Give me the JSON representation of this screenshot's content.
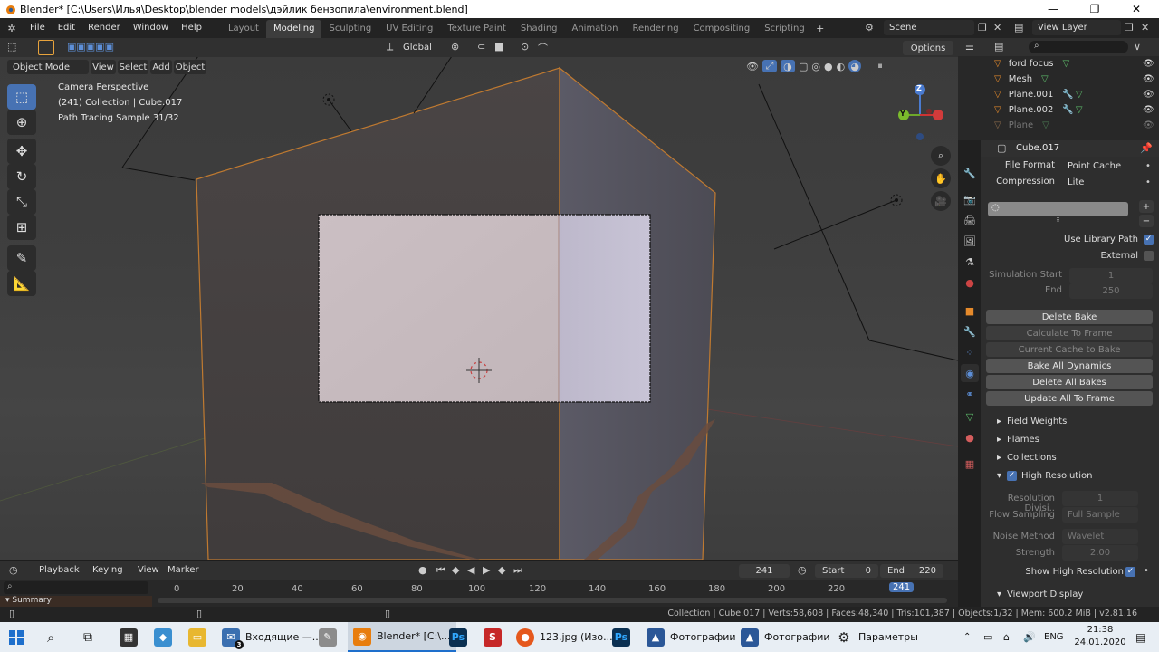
{
  "window": {
    "title": "Blender* [C:\\Users\\Илья\\Desktop\\blender models\\дэйлик бензопила\\environment.blend]",
    "min": "—",
    "max": "❐",
    "close": "✕"
  },
  "menu": [
    "File",
    "Edit",
    "Render",
    "Window",
    "Help"
  ],
  "workspaces": [
    "Layout",
    "Modeling",
    "Sculpting",
    "UV Editing",
    "Texture Paint",
    "Shading",
    "Animation",
    "Rendering",
    "Compositing",
    "Scripting"
  ],
  "active_workspace": "Modeling",
  "scene_field": "Scene",
  "view_layer_field": "View Layer",
  "viewport_header": {
    "mode": "Object Mode",
    "view": "View",
    "select": "Select",
    "add": "Add",
    "object": "Object",
    "transform_orientation": "Global",
    "options": "Options"
  },
  "viewport_overlay_text": {
    "line1": "Camera Perspective",
    "line2": "(241) Collection | Cube.017",
    "line3": "Path Tracing Sample 31/32"
  },
  "gizmo": {
    "x": "X",
    "y": "Y",
    "z": "Z"
  },
  "outliner": {
    "search_placeholder": "",
    "items": [
      {
        "name": "ford focus",
        "dim": false
      },
      {
        "name": "Mesh",
        "dim": false
      },
      {
        "name": "Plane.001",
        "dim": false
      },
      {
        "name": "Plane.002",
        "dim": false
      },
      {
        "name": "Plane",
        "dim": true
      }
    ]
  },
  "properties": {
    "object_name": "Cube.017",
    "file_format_label": "File Format",
    "file_format_value": "Point Cache",
    "compression_label": "Compression",
    "compression_value": "Lite",
    "use_library_path": "Use Library Path",
    "external": "External",
    "simulation_start_label": "Simulation Start",
    "simulation_start_value": "1",
    "end_label": "End",
    "end_value": "250",
    "buttons": [
      "Delete Bake",
      "Calculate To Frame",
      "Current Cache to Bake",
      "Bake All Dynamics",
      "Delete All Bakes",
      "Update All To Frame"
    ],
    "panels": [
      "Field Weights",
      "Flames",
      "Collections"
    ],
    "high_resolution": "High Resolution",
    "resolution_divisions_label": "Resolution Divisi..",
    "resolution_divisions_value": "1",
    "flow_sampling_label": "Flow Sampling",
    "flow_sampling_value": "Full Sample",
    "noise_method_label": "Noise Method",
    "noise_method_value": "Wavelet",
    "strength_label": "Strength",
    "strength_value": "2.00",
    "show_high_resolution": "Show High Resolution",
    "viewport_display": "Viewport Display"
  },
  "timeline": {
    "playback": "Playback",
    "keying": "Keying",
    "view": "View",
    "marker": "Marker",
    "current_frame": "241",
    "start_label": "Start",
    "start_value": "0",
    "end_label": "End",
    "end_value": "220",
    "ticks": [
      "0",
      "20",
      "40",
      "60",
      "80",
      "100",
      "120",
      "140",
      "160",
      "180",
      "200",
      "220"
    ],
    "playhead": "241",
    "summary": "Summary"
  },
  "statusbar": {
    "text": "Collection | Cube.017 | Verts:58,608 | Faces:48,340 | Tris:101,387 | Objects:1/32 | Mem: 600.2 MiB | v2.81.16"
  },
  "taskbar": {
    "items": [
      {
        "label": "Входящие —...",
        "color": "#3a6fb0",
        "icon": "mail-icon"
      },
      {
        "label": "Blender* [C:\\...",
        "color": "#e87d0d",
        "icon": "blender-icon"
      },
      {
        "label": "123.jpg (Изо...",
        "color": "#e5581d",
        "icon": "firefox-icon"
      },
      {
        "label": "Фотографии",
        "color": "#2b5797",
        "icon": "photos-icon"
      },
      {
        "label": "Фотографии",
        "color": "#2b5797",
        "icon": "photos-icon"
      },
      {
        "label": "Параметры",
        "color": "#444",
        "icon": "gear-icon"
      }
    ],
    "lang": "ENG",
    "time": "21:38",
    "date": "24.01.2020",
    "mail_badge": "3"
  }
}
